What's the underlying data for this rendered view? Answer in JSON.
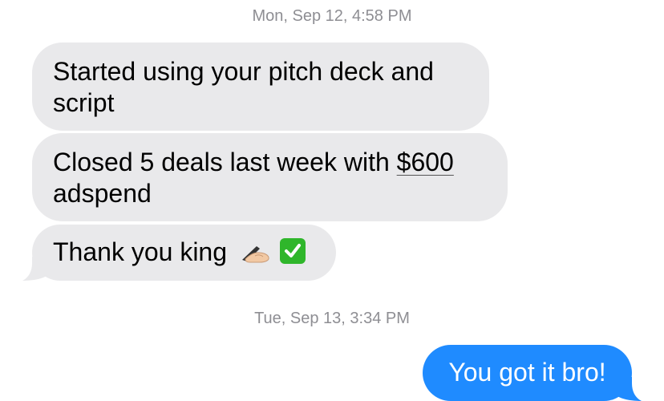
{
  "conversation": {
    "timestamps": [
      "Mon, Sep 12, 4:58 PM",
      "Tue, Sep 13, 3:34 PM"
    ],
    "incoming": {
      "message1": "Started using your pitch deck and script",
      "message2_prefix": "Closed 5 deals last week with ",
      "message2_amount": "$600",
      "message2_suffix": " adspend",
      "message3": "Thank you king"
    },
    "outgoing": {
      "message1": "You got it bro!"
    },
    "emojis": [
      "writing-hand-emoji",
      "check-mark-button-emoji"
    ]
  },
  "colors": {
    "incoming_bubble": "#e9e9eb",
    "outgoing_bubble": "#1f8bff",
    "timestamp_text": "#8e8e93",
    "check_emoji": "#2fb62b"
  }
}
